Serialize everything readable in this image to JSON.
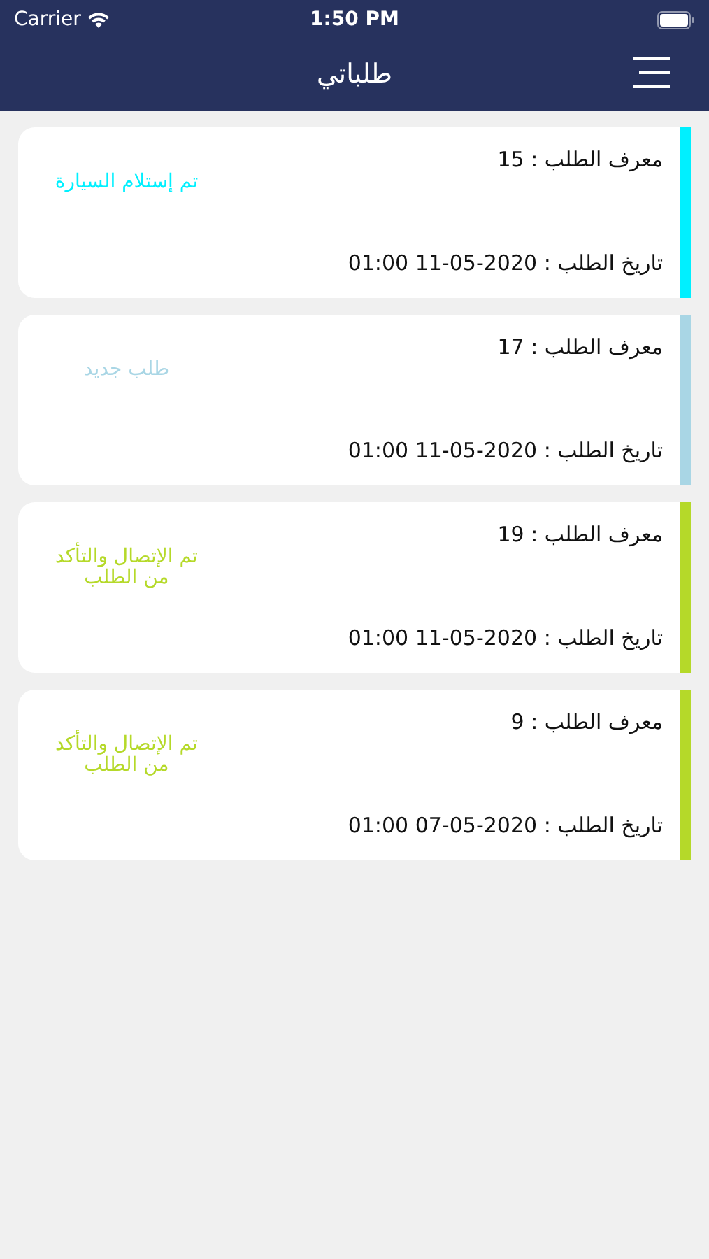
{
  "status_bar": {
    "carrier": "Carrier",
    "time": "1:50 PM"
  },
  "header": {
    "title": "طلباتي"
  },
  "orders": [
    {
      "id_text": "معرف الطلب : 15",
      "status": "تم إستلام السيارة",
      "date_text": "تاريخ الطلب : 2020-05-11 01:00",
      "color": "#00f0ff"
    },
    {
      "id_text": "معرف الطلب : 17",
      "status": "طلب جديد",
      "date_text": "تاريخ الطلب : 2020-05-11 01:00",
      "color": "#a9d6e5"
    },
    {
      "id_text": "معرف الطلب : 19",
      "status": "تم الإتصال والتأكد من الطلب",
      "date_text": "تاريخ الطلب : 2020-05-11 01:00",
      "color": "#b5d929"
    },
    {
      "id_text": "معرف الطلب : 9",
      "status": "تم الإتصال والتأكد من الطلب",
      "date_text": "تاريخ الطلب : 2020-05-07 01:00",
      "color": "#b5d929"
    }
  ]
}
